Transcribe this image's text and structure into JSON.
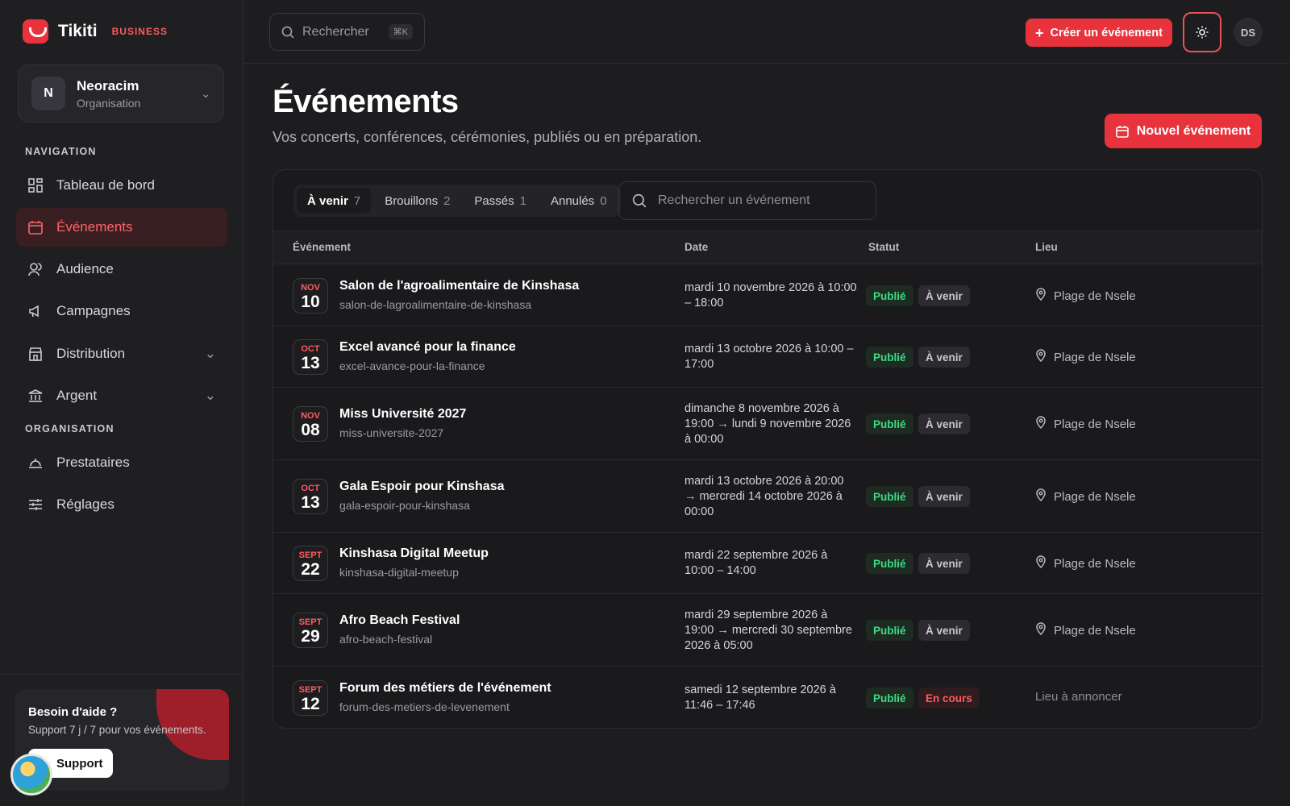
{
  "brand": {
    "name": "Tikiti",
    "badge": "BUSINESS"
  },
  "org": {
    "initial": "N",
    "name": "Neoracim",
    "type": "Organisation"
  },
  "sidebar": {
    "section_nav": "NAVIGATION",
    "section_org": "ORGANISATION",
    "items": [
      {
        "label": "Tableau de bord",
        "icon": "dashboard-icon"
      },
      {
        "label": "Événements",
        "icon": "calendar-icon",
        "active": true
      },
      {
        "label": "Audience",
        "icon": "users-icon"
      },
      {
        "label": "Campagnes",
        "icon": "megaphone-icon"
      },
      {
        "label": "Distribution",
        "icon": "store-icon",
        "expandable": true
      },
      {
        "label": "Argent",
        "icon": "bank-icon",
        "expandable": true
      },
      {
        "label": "Prestataires",
        "icon": "service-icon"
      },
      {
        "label": "Réglages",
        "icon": "sliders-icon"
      }
    ]
  },
  "help": {
    "title": "Besoin d'aide ?",
    "subtitle": "Support 7 j / 7 pour vos événements.",
    "button": "Support"
  },
  "topbar": {
    "search_placeholder": "Rechercher",
    "shortcut": "⌘K",
    "create_label": "Créer un événement",
    "user_initials": "DS"
  },
  "page": {
    "title": "Événements",
    "subtitle": "Vos concerts, conférences, cérémonies, publiés ou en préparation.",
    "new_button": "Nouvel événement"
  },
  "tabs": [
    {
      "label": "À venir",
      "count": "7",
      "active": true
    },
    {
      "label": "Brouillons",
      "count": "2"
    },
    {
      "label": "Passés",
      "count": "1"
    },
    {
      "label": "Annulés",
      "count": "0"
    }
  ],
  "panel_search_placeholder": "Rechercher un événement",
  "table": {
    "headers": {
      "event": "Événement",
      "date": "Date",
      "status": "Statut",
      "venue": "Lieu"
    },
    "rows": [
      {
        "mon": "NOV",
        "day": "10",
        "name": "Salon de l'agroalimentaire de Kinshasa",
        "slug": "salon-de-lagroalimentaire-de-kinshasa",
        "date": "mardi 10 novembre 2026 à 10:00 – 18:00",
        "pub": "Publié",
        "state": "À venir",
        "venue": "Plage de Nsele"
      },
      {
        "mon": "OCT",
        "day": "13",
        "name": "Excel avancé pour la finance",
        "slug": "excel-avance-pour-la-finance",
        "date": "mardi 13 octobre 2026 à 10:00 – 17:00",
        "pub": "Publié",
        "state": "À venir",
        "venue": "Plage de Nsele"
      },
      {
        "mon": "NOV",
        "day": "08",
        "name": "Miss Université 2027",
        "slug": "miss-universite-2027",
        "date": "dimanche 8 novembre 2026 à 19:00 → lundi 9 novembre 2026 à 00:00",
        "pub": "Publié",
        "state": "À venir",
        "venue": "Plage de Nsele"
      },
      {
        "mon": "OCT",
        "day": "13",
        "name": "Gala Espoir pour Kinshasa",
        "slug": "gala-espoir-pour-kinshasa",
        "date": "mardi 13 octobre 2026 à 20:00 → mercredi 14 octobre 2026 à 00:00",
        "pub": "Publié",
        "state": "À venir",
        "venue": "Plage de Nsele"
      },
      {
        "mon": "SEPT",
        "day": "22",
        "name": "Kinshasa Digital Meetup",
        "slug": "kinshasa-digital-meetup",
        "date": "mardi 22 septembre 2026 à 10:00 – 14:00",
        "pub": "Publié",
        "state": "À venir",
        "venue": "Plage de Nsele"
      },
      {
        "mon": "SEPT",
        "day": "29",
        "name": "Afro Beach Festival",
        "slug": "afro-beach-festival",
        "date": "mardi 29 septembre 2026 à 19:00 → mercredi 30 septembre 2026 à 05:00",
        "pub": "Publié",
        "state": "À venir",
        "venue": "Plage de Nsele"
      },
      {
        "mon": "SEPT",
        "day": "12",
        "name": "Forum des métiers de l'événement",
        "slug": "forum-des-metiers-de-levenement",
        "date": "samedi 12 septembre 2026 à 11:46 – 17:46",
        "pub": "Publié",
        "state": "En cours",
        "venue": "Lieu à annoncer"
      }
    ]
  },
  "colors": {
    "accent": "#e8323c",
    "published": "#3ddc84",
    "live": "#ff5a5f",
    "background": "#1d1d20"
  }
}
